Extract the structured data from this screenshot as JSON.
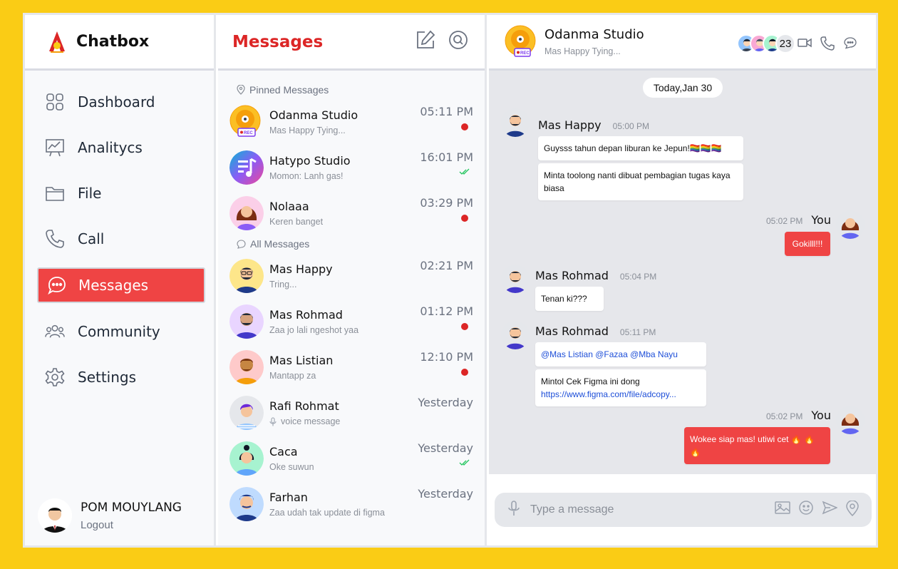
{
  "app": {
    "name": "Chatbox"
  },
  "colors": {
    "accent": "#EF4444",
    "title_red": "#DC2626",
    "background": "#FACC15",
    "link": "#1D4ED8"
  },
  "sidebar": {
    "items": [
      {
        "label": "Dashboard",
        "icon": "dashboard-icon"
      },
      {
        "label": "Analitycs",
        "icon": "analytics-icon"
      },
      {
        "label": "File",
        "icon": "folder-icon"
      },
      {
        "label": "Call",
        "icon": "phone-icon"
      },
      {
        "label": "Messages",
        "icon": "chat-icon",
        "active": true
      },
      {
        "label": "Community",
        "icon": "users-icon"
      },
      {
        "label": "Settings",
        "icon": "gear-icon"
      }
    ],
    "user": {
      "name": "POM MOUYLANG",
      "logout": "Logout"
    }
  },
  "messages_panel": {
    "title": "Messages",
    "pinned_label": "Pinned Messages",
    "all_label": "All Messages",
    "pinned": [
      {
        "name": "Odanma Studio",
        "snippet": "Mas Happy Tying...",
        "time": "05:11 PM",
        "status": "unread"
      },
      {
        "name": "Hatypo Studio",
        "snippet": "Momon: Lanh gas!",
        "time": "16:01 PM",
        "status": "read"
      },
      {
        "name": "Nolaaa",
        "snippet": "Keren banget",
        "time": "03:29 PM",
        "status": "unread"
      }
    ],
    "all": [
      {
        "name": "Mas Happy",
        "snippet": "Tring...",
        "time": "02:21 PM",
        "status": "none"
      },
      {
        "name": "Mas Rohmad",
        "snippet": "Zaa jo lali ngeshot yaa",
        "time": "01:12 PM",
        "status": "unread"
      },
      {
        "name": "Mas Listian",
        "snippet": "Mantapp za",
        "time": "12:10 PM",
        "status": "unread"
      },
      {
        "name": "Rafi Rohmat",
        "snippet": "voice message",
        "time": "Yesterday",
        "status": "none"
      },
      {
        "name": "Caca",
        "snippet": "Oke suwun",
        "time": "Yesterday",
        "status": "read"
      },
      {
        "name": "Farhan",
        "snippet": "Zaa udah tak update di figma",
        "time": "Yesterday",
        "status": "none"
      }
    ]
  },
  "chat": {
    "title": "Odanma Studio",
    "subtitle": "Mas Happy Tying...",
    "member_count": "23",
    "date_label": "Today,Jan 30",
    "messages": [
      {
        "sender": "Mas Happy",
        "time": "05:00 PM",
        "lines": [
          "Guysss tahun depan liburan ke Jepun!🏳️‍🌈🏳️‍🌈🏳️‍🌈",
          "Minta toolong nanti dibuat pembagian tugas kaya biasa"
        ]
      },
      {
        "sender": "You",
        "time": "05:02 PM",
        "lines": [
          "Gokilll!!!"
        ]
      },
      {
        "sender": "Mas Rohmad",
        "time": "05:04 PM",
        "lines": [
          "Tenan ki???"
        ]
      },
      {
        "sender": "Mas Rohmad",
        "time": "05:11 PM",
        "lines": [
          "@Mas Listian @Fazaa @Mba Nayu",
          "Mintol Cek Figma ini dong",
          "https://www.figma.com/file/adcopy..."
        ]
      },
      {
        "sender": "You",
        "time": "05:02 PM",
        "lines": [
          "Wokee siap mas! utiwi cet 🔥 🔥 🔥"
        ]
      }
    ],
    "composer_placeholder": "Type a message"
  }
}
